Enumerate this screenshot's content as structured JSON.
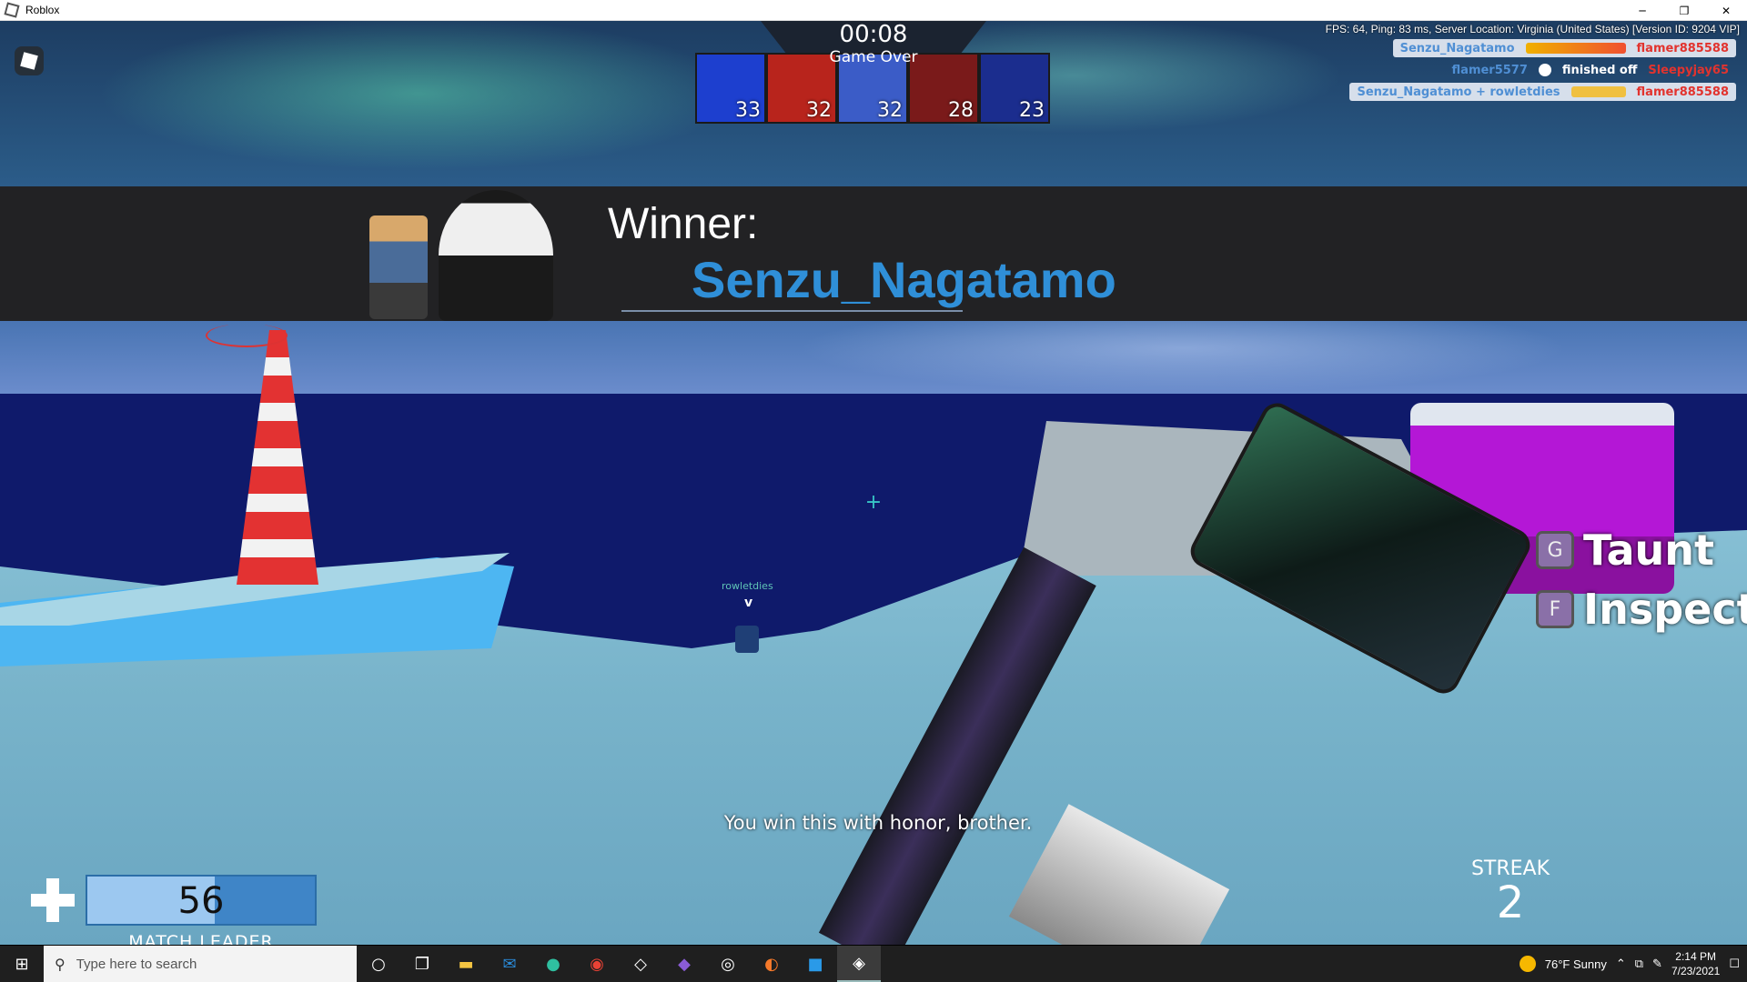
{
  "window": {
    "title": "Roblox",
    "controls": [
      "─",
      "❐",
      "✕"
    ]
  },
  "hud": {
    "timer": "00:08",
    "status": "Game Over",
    "stats_line": "FPS: 64, Ping: 83 ms, Server Location: Virginia (United States)  [Version ID: 9204 VIP]",
    "scores": [
      "33",
      "32",
      "32",
      "28",
      "23"
    ],
    "portrait_colors": [
      "#1d3fcf",
      "#b8241c",
      "#3b5cc7",
      "#7a1a1a",
      "#1b2d8e"
    ]
  },
  "killfeed": [
    {
      "left": "Senzu_Nagatamo",
      "middle": "",
      "right": "flamer885588",
      "boxed": true
    },
    {
      "left": "flamer5577",
      "middle": "finished off",
      "right": "Sleepyjay65",
      "boxed": false
    },
    {
      "left": "Senzu_Nagatamo + rowletdies",
      "middle": "",
      "right": "flamer885588",
      "boxed": true
    }
  ],
  "winner": {
    "label": "Winner:",
    "name": "Senzu_Nagatamo"
  },
  "prompts": [
    {
      "key": "G",
      "label": "Taunt"
    },
    {
      "key": "F",
      "label": "Inspect"
    }
  ],
  "world": {
    "player_tag": "rowletdies",
    "player_marker": "v"
  },
  "subtitle": "You win this with honor, brother.",
  "health": {
    "value": "56",
    "fill_fraction": 0.56,
    "label": "MATCH LEADER"
  },
  "streak": {
    "label": "STREAK",
    "value": "2"
  },
  "taskbar": {
    "search_placeholder": "Type here to search",
    "apps": [
      "cortana-icon",
      "task-view-icon",
      "file-explorer-icon",
      "mail-icon",
      "edge-icon",
      "chrome-icon",
      "unity-icon",
      "visual-studio-icon",
      "obs-icon",
      "blender-icon",
      "roblox-studio-icon",
      "roblox-icon"
    ],
    "weather": "76°F  Sunny",
    "time": "2:14 PM",
    "date": "7/23/2021"
  }
}
